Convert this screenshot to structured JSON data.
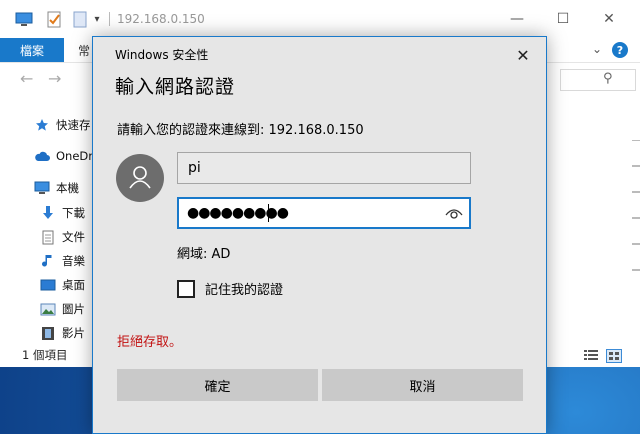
{
  "explorer": {
    "address_title": "192.168.0.150",
    "tabs": {
      "file": "檔案",
      "home": "常"
    },
    "window_controls": {
      "minimize": "—",
      "maximize": "☐",
      "close": "✕"
    },
    "nav_items": [
      {
        "label": "快速存",
        "icon": "star-icon"
      },
      {
        "label": "OneDr",
        "icon": "cloud-icon"
      },
      {
        "label": "本機",
        "icon": "computer-icon"
      },
      {
        "label": "下載",
        "icon": "download-arrow-icon"
      },
      {
        "label": "文件",
        "icon": "document-icon"
      },
      {
        "label": "音樂",
        "icon": "music-note-icon"
      },
      {
        "label": "桌面",
        "icon": "desktop-icon"
      },
      {
        "label": "圖片",
        "icon": "picture-icon"
      },
      {
        "label": "影片",
        "icon": "video-icon"
      }
    ],
    "status_text": "1 個項目"
  },
  "dialog": {
    "caption": "Windows 安全性",
    "heading": "輸入網路認證",
    "prompt": "請輸入您的認證來連線到: 192.168.0.150",
    "username_value": "pi",
    "password_mask": "●●●●●●●●●",
    "domain_line": "網域: AD",
    "remember_label": "記住我的認證",
    "remember_checked": false,
    "error_text": "拒絕存取。",
    "ok_label": "確定",
    "cancel_label": "取消",
    "close_glyph": "✕"
  },
  "colors": {
    "accent": "#1979ca",
    "error": "#c21313",
    "dialog_bg": "#e6e6e6",
    "button_bg": "#c9c9c9"
  }
}
